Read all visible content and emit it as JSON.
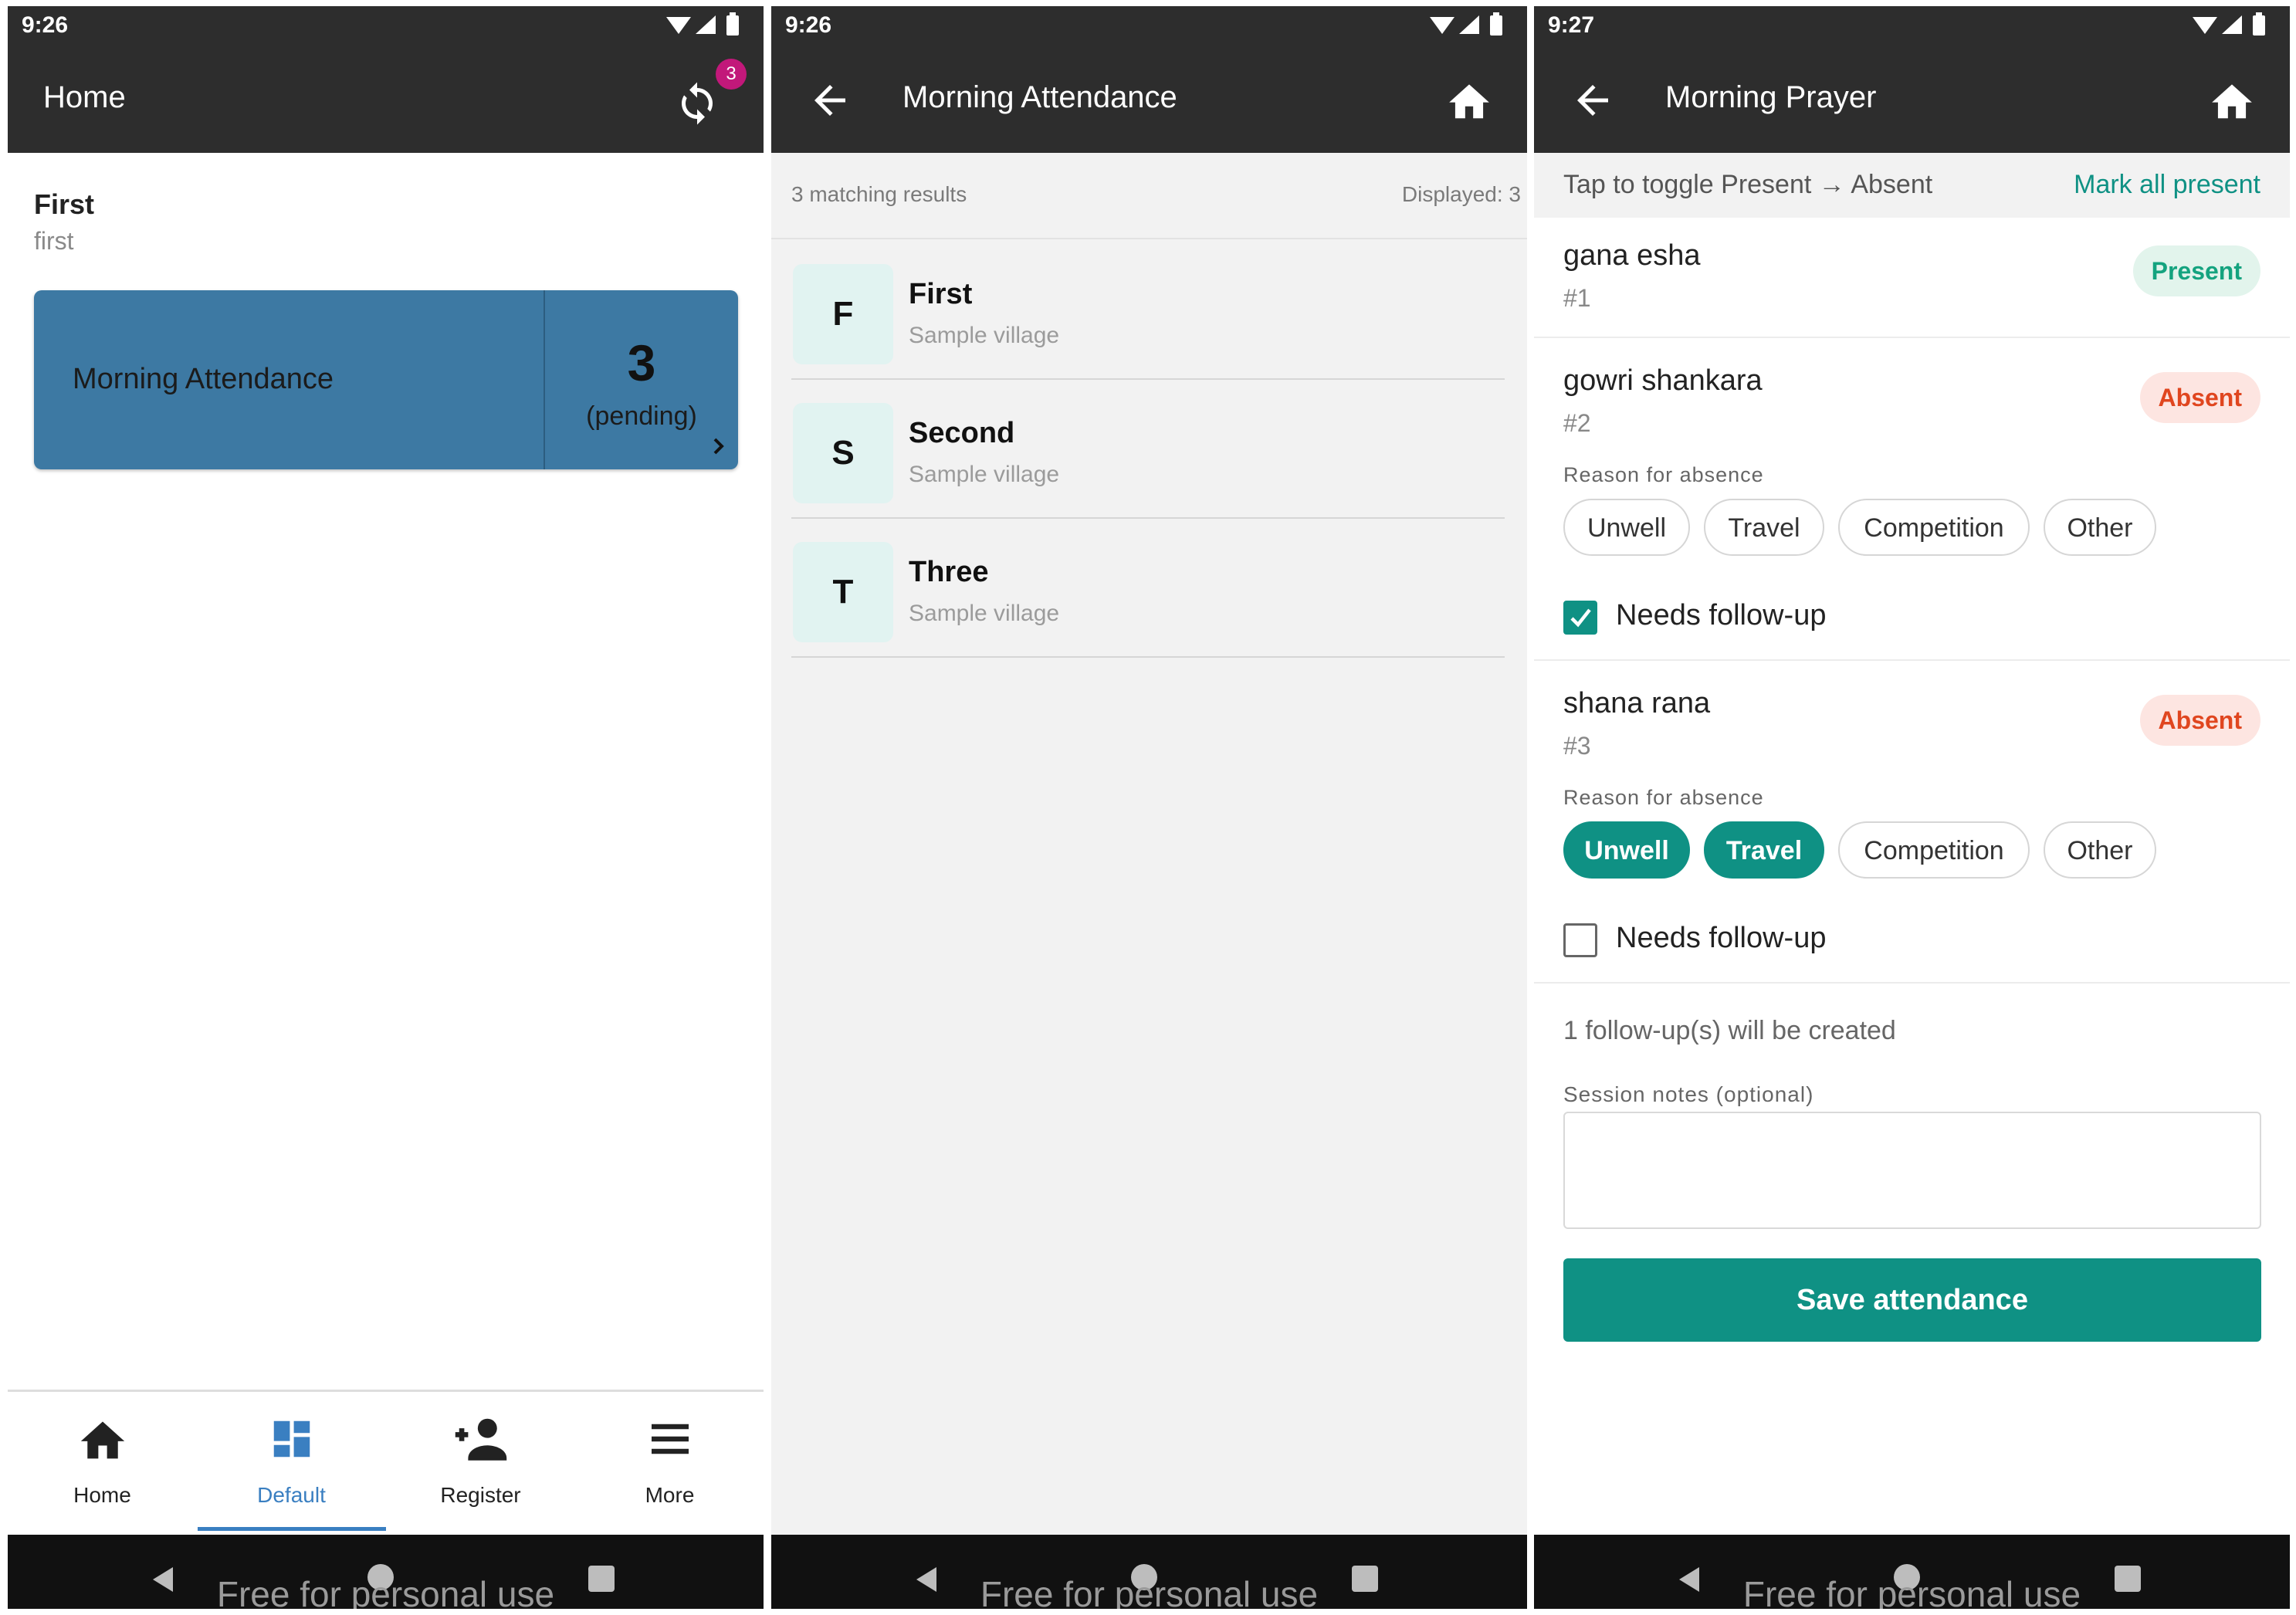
{
  "colors": {
    "teal": "#0f9184",
    "blue_card": "#3d79a3",
    "nav_blue": "#3a7fc1",
    "badge_pink": "#c2187a",
    "appbar": "#2d2d2d"
  },
  "watermark": "Free for personal use",
  "panel1": {
    "time": "9:26",
    "title": "Home",
    "sync_badge": "3",
    "user_name": "First",
    "user_sub": "first",
    "card": {
      "label": "Morning Attendance",
      "count": "3",
      "pending": "(pending)"
    },
    "bottom_nav": [
      {
        "label": "Home",
        "icon": "home-icon"
      },
      {
        "label": "Default",
        "icon": "dashboard-icon",
        "active": true
      },
      {
        "label": "Register",
        "icon": "add-person-icon"
      },
      {
        "label": "More",
        "icon": "menu-icon"
      }
    ]
  },
  "panel2": {
    "time": "9:26",
    "title": "Morning Attendance",
    "results": "3 matching results",
    "displayed": "Displayed: 3",
    "rows": [
      {
        "initial": "F",
        "name": "First",
        "village": "Sample village"
      },
      {
        "initial": "S",
        "name": "Second",
        "village": "Sample village"
      },
      {
        "initial": "T",
        "name": "Three",
        "village": "Sample village"
      }
    ]
  },
  "panel3": {
    "time": "9:27",
    "title": "Morning Prayer",
    "toggle_hint": "Tap to toggle Present → Absent",
    "mark_all": "Mark all present",
    "reason_label": "Reason for absence",
    "reasons": [
      "Unwell",
      "Travel",
      "Competition",
      "Other"
    ],
    "followup_label": "Needs follow-up",
    "people": [
      {
        "name": "gana esha",
        "num": "#1",
        "status": "Present"
      },
      {
        "name": "gowri shankara",
        "num": "#2",
        "status": "Absent",
        "selected_reasons": [],
        "needs_followup": true
      },
      {
        "name": "shana rana",
        "num": "#3",
        "status": "Absent",
        "selected_reasons": [
          "Unwell",
          "Travel"
        ],
        "needs_followup": false
      }
    ],
    "followup_count": "1 follow-up(s) will be created",
    "notes_label": "Session notes (optional)",
    "notes_value": "",
    "save_label": "Save attendance"
  }
}
